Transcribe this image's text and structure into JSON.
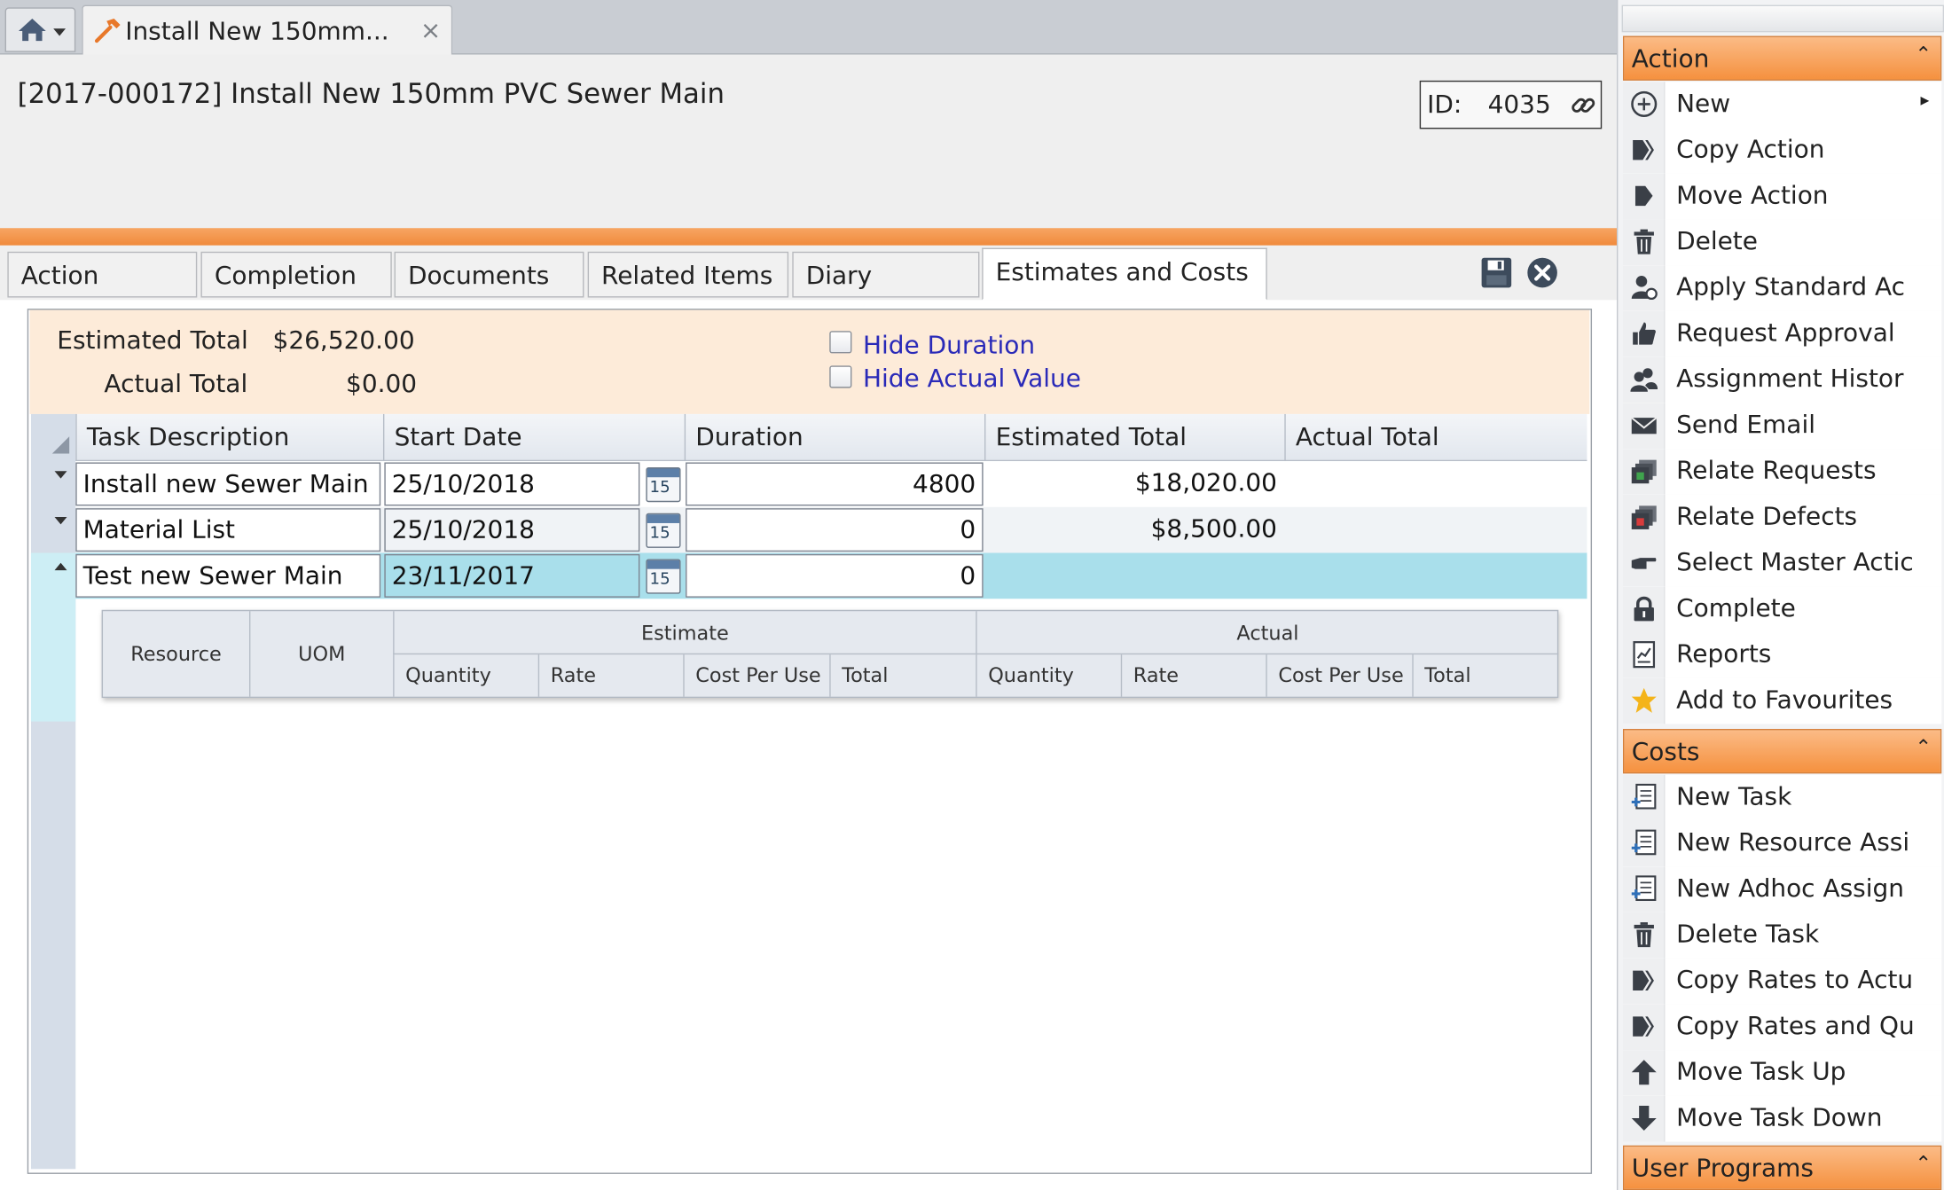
{
  "tab": {
    "title": "Install New 150mm...",
    "close": "×"
  },
  "header": {
    "title": "[2017-000172] Install New 150mm PVC Sewer Main",
    "id_label": "ID:",
    "id_value": "4035"
  },
  "tabs": [
    "Action",
    "Completion",
    "Documents",
    "Related Items",
    "Diary",
    "Estimates and Costs"
  ],
  "active_tab": "Estimates and Costs",
  "summary": {
    "estimated_label": "Estimated Total",
    "estimated_value": "$26,520.00",
    "actual_label": "Actual Total",
    "actual_value": "$0.00",
    "hide_duration": "Hide Duration",
    "hide_actual": "Hide Actual Value"
  },
  "grid": {
    "columns": [
      "Task Description",
      "Start Date",
      "Duration",
      "Estimated Total",
      "Actual Total"
    ],
    "calendar_day": "15",
    "rows": [
      {
        "task": "Install new Sewer Main",
        "start": "25/10/2018",
        "duration": "4800",
        "estimated": "$18,020.00",
        "actual": ""
      },
      {
        "task": "Material List",
        "start": "25/10/2018",
        "duration": "0",
        "estimated": "$8,500.00",
        "actual": ""
      },
      {
        "task": "Test new Sewer Main",
        "start": "23/11/2017",
        "duration": "0",
        "estimated": "",
        "actual": ""
      }
    ]
  },
  "subgrid": {
    "resource": "Resource",
    "uom": "UOM",
    "estimate": "Estimate",
    "actual": "Actual",
    "sub_columns": [
      "Quantity",
      "Rate",
      "Cost Per Use",
      "Total"
    ]
  },
  "right_panel": {
    "sections": [
      {
        "title": "Action",
        "items": [
          {
            "label": "New",
            "icon": "plus-circle-icon",
            "submenu": true
          },
          {
            "label": "Copy Action",
            "icon": "copy-action-icon"
          },
          {
            "label": "Move Action",
            "icon": "move-action-icon"
          },
          {
            "label": "Delete",
            "icon": "trash-icon"
          },
          {
            "label": "Apply Standard Ac",
            "icon": "user-gear-icon"
          },
          {
            "label": "Request Approval",
            "icon": "thumbs-up-icon"
          },
          {
            "label": "Assignment Histor",
            "icon": "users-icon"
          },
          {
            "label": "Send Email",
            "icon": "envelope-icon"
          },
          {
            "label": "Relate Requests",
            "icon": "relate-requests-icon"
          },
          {
            "label": "Relate Defects",
            "icon": "relate-defects-icon"
          },
          {
            "label": "Select Master Actic",
            "icon": "pointing-hand-icon"
          },
          {
            "label": "Complete",
            "icon": "lock-icon"
          },
          {
            "label": "Reports",
            "icon": "report-icon"
          },
          {
            "label": "Add to Favourites",
            "icon": "star-icon"
          }
        ]
      },
      {
        "title": "Costs",
        "items": [
          {
            "label": "New Task",
            "icon": "new-task-icon"
          },
          {
            "label": "New Resource Assi",
            "icon": "new-resource-icon"
          },
          {
            "label": "New Adhoc Assign",
            "icon": "new-adhoc-icon"
          },
          {
            "label": "Delete Task",
            "icon": "trash-icon"
          },
          {
            "label": "Copy Rates to Actu",
            "icon": "copy-rates-icon"
          },
          {
            "label": "Copy Rates and Qu",
            "icon": "copy-rates-qty-icon"
          },
          {
            "label": "Move Task Up",
            "icon": "arrow-up-icon"
          },
          {
            "label": "Move Task Down",
            "icon": "arrow-down-icon"
          }
        ]
      },
      {
        "title": "User Programs",
        "items": []
      }
    ]
  },
  "colors": {
    "accent": "#f5913f",
    "selected_row": "#a9dfeb",
    "summary_bg": "#fdebd9",
    "link": "#2a2ab8"
  }
}
